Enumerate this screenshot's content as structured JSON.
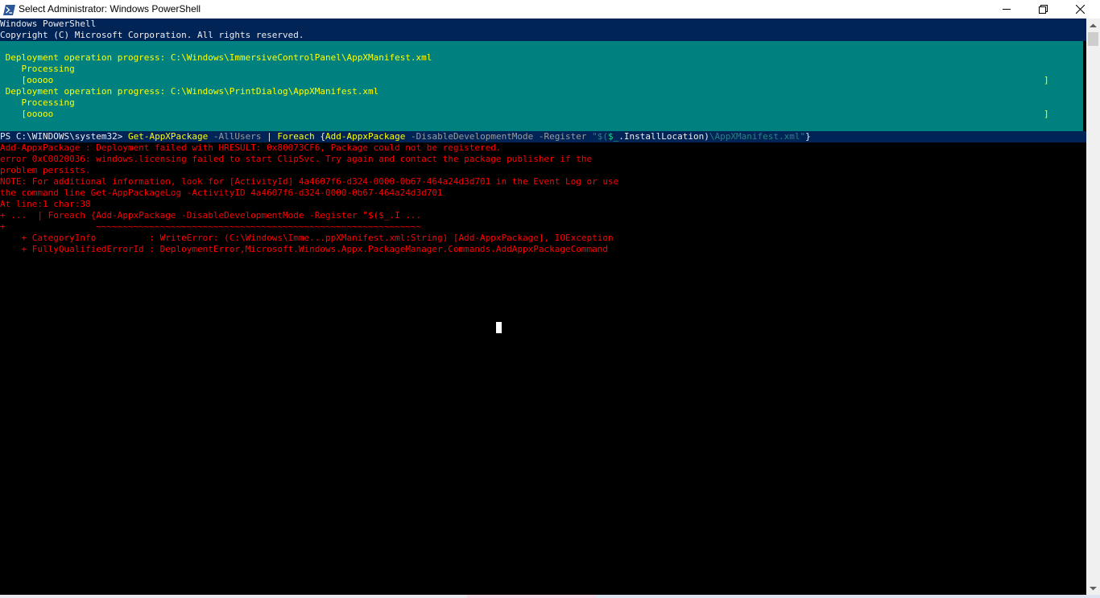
{
  "window": {
    "title": "Select Administrator: Windows PowerShell",
    "icon": "powershell-icon",
    "controls": {
      "minimize": "minimize-icon",
      "maximize": "restore-icon",
      "close": "close-icon"
    }
  },
  "colors": {
    "console_bg": "#000000",
    "banner_bg": "#012456",
    "progress_bg": "#00807f",
    "progress_text": "#ffff00",
    "error_text": "#ff0000",
    "normal_text": "#eeedf0",
    "command_text": "#ffff00",
    "parameter_text": "#9b9b9b"
  },
  "console": {
    "banner_line1": "Windows PowerShell",
    "banner_line2": "Copyright (C) Microsoft Corporation. All rights reserved.",
    "progress": [
      {
        "activity": " Deployment operation progress: C:\\Windows\\ImmersiveControlPanel\\AppXManifest.xml",
        "status": "    Processing",
        "bar": "    [ooooo",
        "bar_end": "]"
      },
      {
        "activity": " Deployment operation progress: C:\\Windows\\PrintDialog\\AppXManifest.xml",
        "status": "    Processing",
        "bar": "    [ooooo",
        "bar_end": "]"
      }
    ],
    "prompt": {
      "path": "PS C:\\WINDOWS\\system32> ",
      "cmd1": "Get-AppXPackage",
      "param1": " -AllUsers",
      "pipe": " | ",
      "cmd2": "Foreach",
      "brace": " {",
      "cmd3": "Add-AppxPackage",
      "param2": " -DisableDevelopmentMode",
      "param3": " -Register",
      "str_open": " \"$(",
      "var": "$_",
      "member": ".InstallLocation)",
      "str_rest": "\\AppXManifest.xml\"",
      "close": "}"
    },
    "errors": [
      "Add-AppxPackage : Deployment failed with HRESULT: 0x80073CF6, Package could not be registered.",
      "error 0xC0020036: windows.licensing failed to start ClipSvc. Try again and contact the package publisher if the",
      "problem persists.",
      "NOTE: For additional information, look for [ActivityId] 4a4607f6-d324-0000-0b67-464a24d3d701 in the Event Log or use",
      "the command line Get-AppPackageLog -ActivityID 4a4607f6-d324-0000-0b67-464a24d3d701",
      "At line:1 char:38",
      "+ ...  | Foreach {Add-AppxPackage -DisableDevelopmentMode -Register \"$($_.I ...",
      "+                 ~~~~~~~~~~~~~~~~~~~~~~~~~~~~~~~~~~~~~~~~~~~~~~~~~~~~~~~~~~~~~",
      "    + CategoryInfo          : WriteError: (C:\\Windows\\Imme...ppXManifest.xml:String) [Add-AppxPackage], IOException",
      "    + FullyQualifiedErrorId : DeploymentError,Microsoft.Windows.Appx.PackageManager.Commands.AddAppxPackageCommand"
    ]
  },
  "scrollbar": {
    "up": "scroll-up-arrow-icon",
    "down": "scroll-down-arrow-icon"
  }
}
